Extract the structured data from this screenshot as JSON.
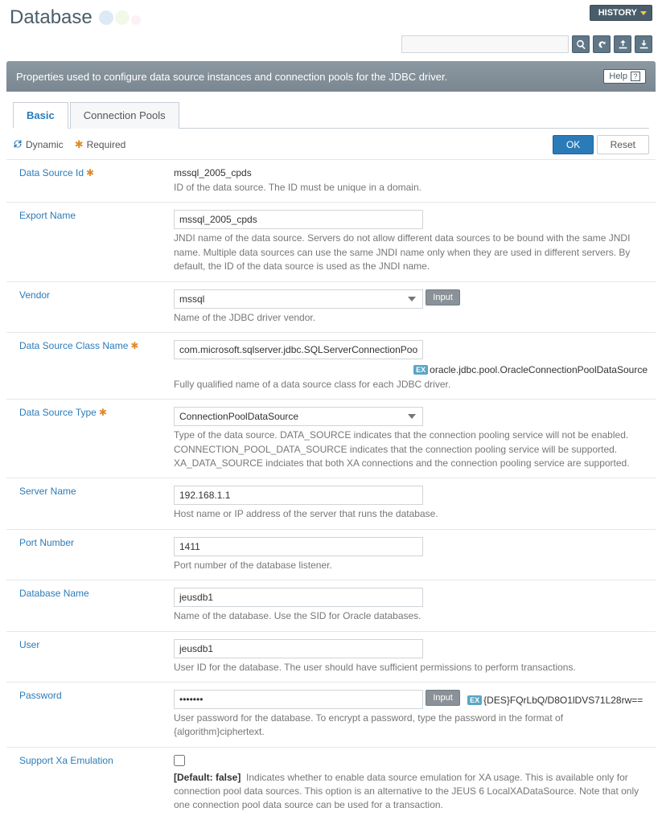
{
  "header": {
    "title": "Database",
    "history_label": "HISTORY"
  },
  "description_bar": "Properties used to configure data source instances and connection pools for the JDBC driver.",
  "help_label": "Help",
  "tabs": [
    {
      "label": "Basic",
      "active": true
    },
    {
      "label": "Connection Pools",
      "active": false
    }
  ],
  "legend": {
    "dynamic": "Dynamic",
    "required": "Required"
  },
  "actions": {
    "ok": "OK",
    "reset": "Reset"
  },
  "fields": {
    "data_source_id": {
      "label": "Data Source Id",
      "required": true,
      "value": "mssql_2005_cpds",
      "hint": "ID of the data source. The ID must be unique in a domain."
    },
    "export_name": {
      "label": "Export Name",
      "value": "mssql_2005_cpds",
      "hint": "JNDI name of the data source. Servers do not allow different data sources to be bound with the same JNDI name. Multiple data sources can use the same JNDI name only when they are used in different servers. By default, the ID of the data source is used as the JNDI name."
    },
    "vendor": {
      "label": "Vendor",
      "value": "mssql",
      "input_btn": "Input",
      "hint": "Name of the JDBC driver vendor."
    },
    "ds_class": {
      "label": "Data Source Class Name",
      "required": true,
      "value": "com.microsoft.sqlserver.jdbc.SQLServerConnectionPoolDataSource",
      "example": "oracle.jdbc.pool.OracleConnectionPoolDataSource",
      "hint": "Fully qualified name of a data source class for each JDBC driver."
    },
    "ds_type": {
      "label": "Data Source Type",
      "required": true,
      "value": "ConnectionPoolDataSource",
      "hint": "Type of the data source. DATA_SOURCE indicates that the connection pooling service will not be enabled. CONNECTION_POOL_DATA_SOURCE indicates that the connection pooling service will be supported. XA_DATA_SOURCE indciates that both XA connections and the connection pooling service are supported."
    },
    "server_name": {
      "label": "Server Name",
      "value": "192.168.1.1",
      "hint": "Host name or IP address of the server that runs the database."
    },
    "port_number": {
      "label": "Port Number",
      "value": "1411",
      "hint": "Port number of the database listener."
    },
    "database_name": {
      "label": "Database Name",
      "value": "jeusdb1",
      "hint": "Name of the database. Use the SID for Oracle databases."
    },
    "user": {
      "label": "User",
      "value": "jeusdb1",
      "hint": "User ID for the database. The user should have sufficient permissions to perform transactions."
    },
    "password": {
      "label": "Password",
      "value": "•••••••",
      "input_btn": "Input",
      "example": "{DES}FQrLbQ/D8O1lDVS71L28rw==",
      "hint": "User password for the database. To encrypt a password, type the password in the format of {algorithm}ciphertext."
    },
    "support_xa": {
      "label": "Support Xa Emulation",
      "default_label": "[Default: false]",
      "hint": "Indicates whether to enable data source emulation for XA usage. This is available only for connection pool data sources. This option is an alternative to the JEUS 6 LocalXADataSource. Note that only one connection pool data source can be used for a transaction."
    }
  },
  "ex_label": "EX"
}
